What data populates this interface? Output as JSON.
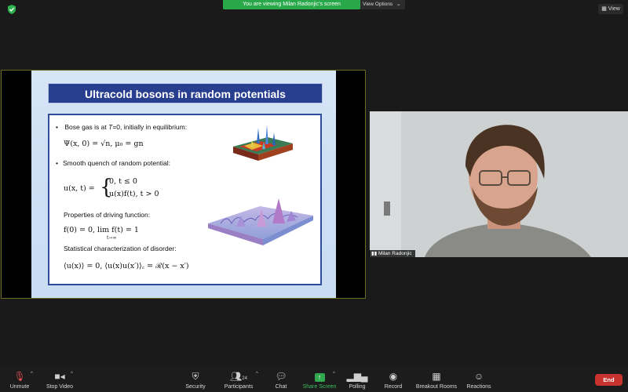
{
  "top": {
    "banner_text": "You are viewing Milan Radonjic's screen",
    "view_options_label": "View Options",
    "view_label": "View"
  },
  "slide": {
    "title": "Ultracold bosons in random potentials",
    "bullet1_pre": "Bose gas is at ",
    "bullet1_var": "T",
    "bullet1_post": "=0, initially in equilibrium:",
    "eq1": "Ψ(x, 0) = √n,    μ₀ = gn",
    "bullet2": "Smooth quench of random potential:",
    "eq2_lhs": "u(x, t) =",
    "eq2_case1": "0,                t ≤ 0",
    "eq2_case2": "u(x)f(t),     t > 0",
    "props_label": "Properties of driving function:",
    "eq3": "f(0) = 0,    lim f(t) = 1",
    "eq3_sub": "t→∞",
    "stat_label": "Statistical characterization of disorder:",
    "eq4": "⟨u(x)⟩ = 0,    ⟨u(x)u(x′)⟩꜀ = ℛ(x − x′)"
  },
  "camera": {
    "participant_name": "Milan Radonjic"
  },
  "toolbar": {
    "unmute": "Unmute",
    "stop_video": "Stop Video",
    "security": "Security",
    "participants": "Participants",
    "participants_count": "24",
    "chat": "Chat",
    "share_screen": "Share Screen",
    "polling": "Polling",
    "record": "Record",
    "breakout_rooms": "Breakout Rooms",
    "reactions": "Reactions",
    "end": "End"
  },
  "colors": {
    "banner_green": "#29a84a",
    "slide_title_bg": "#283f8f",
    "end_red": "#c8332f",
    "share_green": "#2fa84f"
  }
}
